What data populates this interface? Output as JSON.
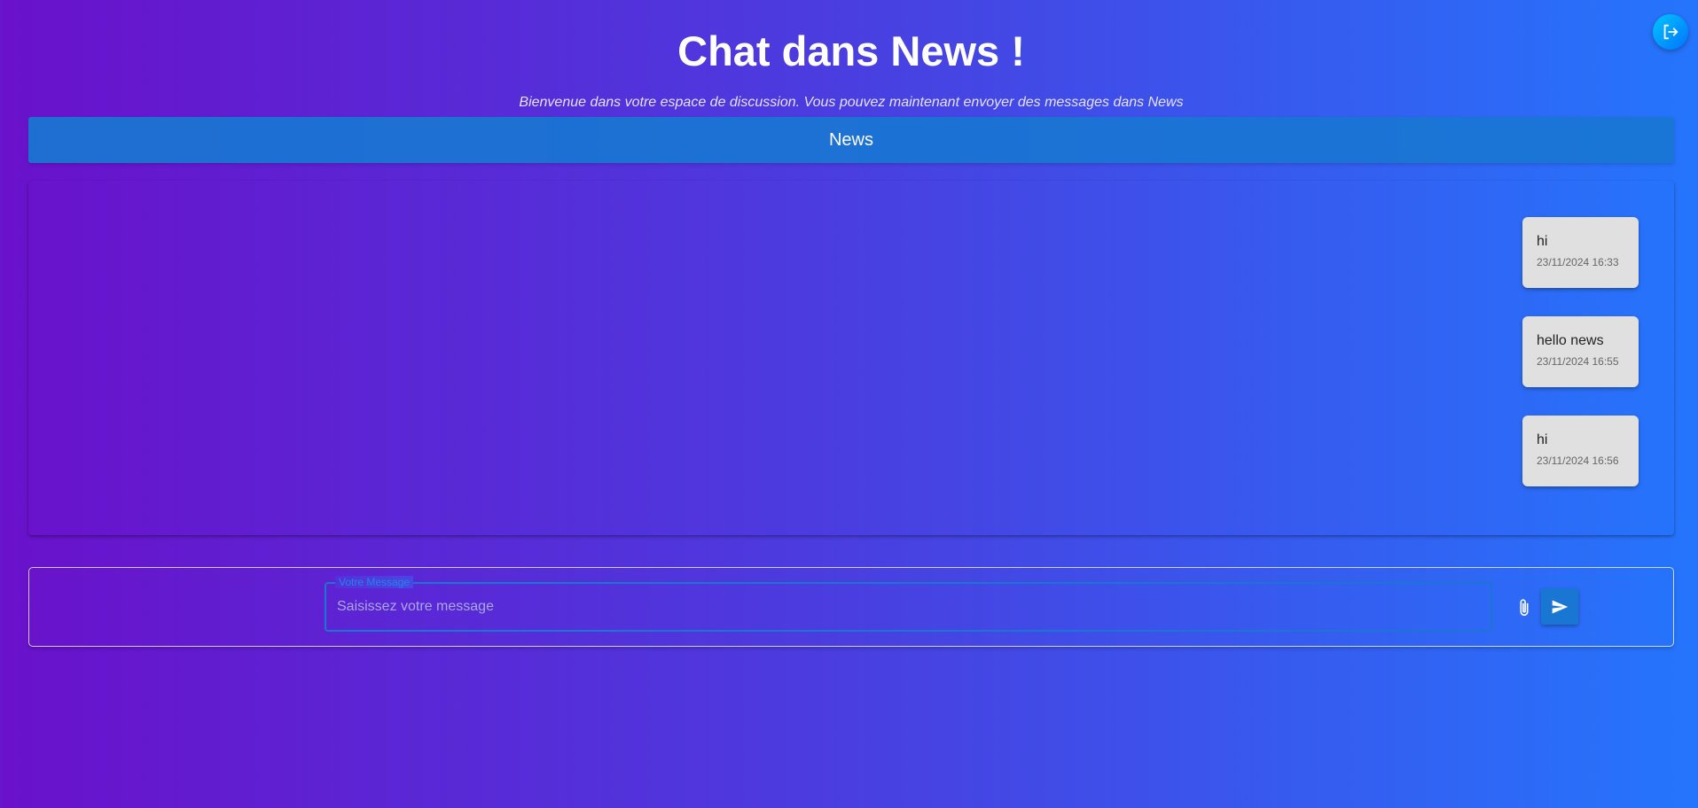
{
  "header": {
    "title": "Chat dans News !",
    "subtitle": "Bienvenue dans votre espace de discussion. Vous pouvez maintenant envoyer des messages dans News",
    "logout_icon": "logout-icon"
  },
  "channel": {
    "name": "News"
  },
  "messages": [
    {
      "text": "hi",
      "time": "23/11/2024 16:33"
    },
    {
      "text": "hello news",
      "time": "23/11/2024 16:55"
    },
    {
      "text": "hi",
      "time": "23/11/2024 16:56"
    }
  ],
  "composer": {
    "label": "Votre Message",
    "placeholder": "Saisissez votre message",
    "value": "",
    "attach_icon": "paperclip-icon",
    "send_icon": "send-icon"
  },
  "colors": {
    "background_start": "#6a11cb",
    "background_end": "#2575fc",
    "primary": "#1976d2",
    "bubble": "#e0e0e0"
  }
}
